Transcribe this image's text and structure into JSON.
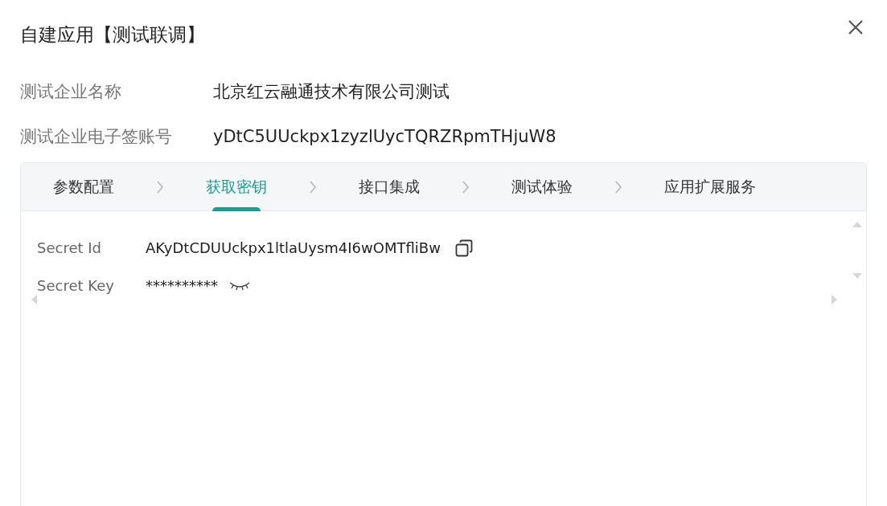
{
  "dialog": {
    "title": "自建应用【测试联调】"
  },
  "info": [
    {
      "label": "测试企业名称",
      "value": "北京红云融通技术有限公司测试"
    },
    {
      "label": "测试企业电子签账号",
      "value": "yDtC5UUckpx1zyzlUycTQRZRpmTHjuW8"
    }
  ],
  "steps": [
    {
      "label": "参数配置",
      "selected": false
    },
    {
      "label": "获取密钥",
      "selected": true
    },
    {
      "label": "接口集成",
      "selected": false
    },
    {
      "label": "测试体验",
      "selected": false
    },
    {
      "label": "应用扩展服务",
      "selected": false
    }
  ],
  "secret": {
    "id_label": "Secret Id",
    "id_value": "AKyDtCDUUckpx1ltlaUysm4I6wOMTfliBw",
    "key_label": "Secret Key",
    "key_value": "**********"
  }
}
